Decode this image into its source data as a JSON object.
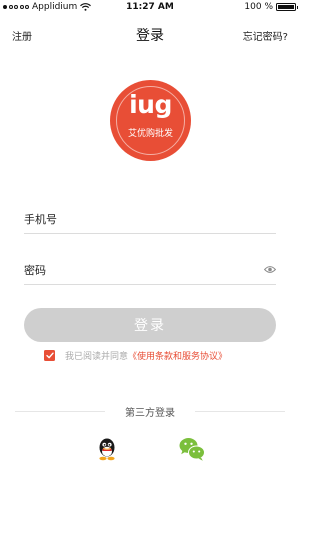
{
  "status_bar": {
    "carrier": "Applidium",
    "time": "11:27 AM",
    "battery": "100 %",
    "battery_level": 1.0
  },
  "nav": {
    "left": "注册",
    "title": "登录",
    "right": "忘记密码?"
  },
  "logo": {
    "text": "iug",
    "subtitle": "艾优购批发",
    "color": "#e84e36"
  },
  "form": {
    "phone_placeholder": "手机号",
    "password_placeholder": "密码",
    "login_label": "登录",
    "agree_text": "我已阅读并同意",
    "agree_link": "《使用条款和服务协议》",
    "agree_checked": true
  },
  "third_party": {
    "label": "第三方登录",
    "icons": [
      "qq-icon",
      "wechat-icon"
    ]
  },
  "colors": {
    "accent": "#e84e36",
    "disabled_button": "#cfcfcf",
    "wechat": "#7bbf3c"
  }
}
